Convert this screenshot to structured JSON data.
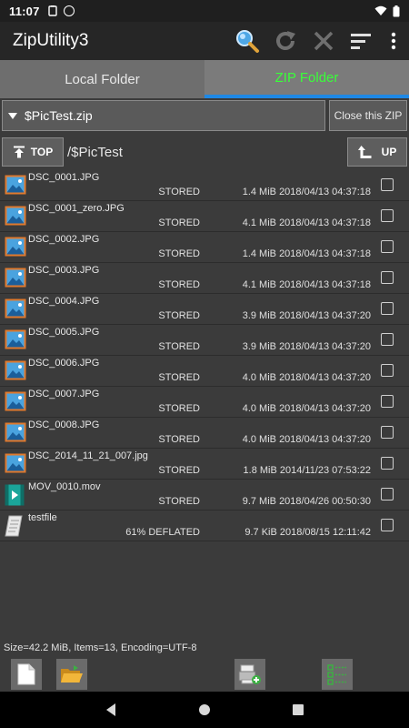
{
  "status_bar": {
    "time": "11:07"
  },
  "app": {
    "title": "ZipUtility3"
  },
  "tabs": [
    {
      "label": "Local Folder",
      "active": false
    },
    {
      "label": "ZIP Folder",
      "active": true
    }
  ],
  "zip": {
    "selected": "$PicTest.zip",
    "close_label": "Close this ZIP"
  },
  "nav": {
    "top_label": "TOP",
    "path": "/$PicTest",
    "up_label": "UP"
  },
  "files": [
    {
      "name": "DSC_0001.JPG",
      "method": "STORED",
      "size": "1.4 MiB",
      "datetime": "2018/04/13 04:37:18",
      "type": "image",
      "checked": false
    },
    {
      "name": "DSC_0001_zero.JPG",
      "method": "STORED",
      "size": "4.1 MiB",
      "datetime": "2018/04/13 04:37:18",
      "type": "image",
      "checked": false
    },
    {
      "name": "DSC_0002.JPG",
      "method": "STORED",
      "size": "1.4 MiB",
      "datetime": "2018/04/13 04:37:18",
      "type": "image",
      "checked": false
    },
    {
      "name": "DSC_0003.JPG",
      "method": "STORED",
      "size": "4.1 MiB",
      "datetime": "2018/04/13 04:37:18",
      "type": "image",
      "checked": false
    },
    {
      "name": "DSC_0004.JPG",
      "method": "STORED",
      "size": "3.9 MiB",
      "datetime": "2018/04/13 04:37:20",
      "type": "image",
      "checked": false
    },
    {
      "name": "DSC_0005.JPG",
      "method": "STORED",
      "size": "3.9 MiB",
      "datetime": "2018/04/13 04:37:20",
      "type": "image",
      "checked": false
    },
    {
      "name": "DSC_0006.JPG",
      "method": "STORED",
      "size": "4.0 MiB",
      "datetime": "2018/04/13 04:37:20",
      "type": "image",
      "checked": false
    },
    {
      "name": "DSC_0007.JPG",
      "method": "STORED",
      "size": "4.0 MiB",
      "datetime": "2018/04/13 04:37:20",
      "type": "image",
      "checked": false
    },
    {
      "name": "DSC_0008.JPG",
      "method": "STORED",
      "size": "4.0 MiB",
      "datetime": "2018/04/13 04:37:20",
      "type": "image",
      "checked": false
    },
    {
      "name": "DSC_2014_11_21_007.jpg",
      "method": "STORED",
      "size": "1.8 MiB",
      "datetime": "2014/11/23 07:53:22",
      "type": "image",
      "checked": false
    },
    {
      "name": "MOV_0010.mov",
      "method": "STORED",
      "size": "9.7 MiB",
      "datetime": "2018/04/26 00:50:30",
      "type": "video",
      "checked": false
    },
    {
      "name": "testfile",
      "method": "61% DEFLATED",
      "size": "9.7 KiB",
      "datetime": "2018/08/15 12:11:42",
      "type": "file",
      "checked": false
    }
  ],
  "footer": {
    "summary": "Size=42.2 MiB, Items=13, Encoding=UTF-8"
  },
  "colors": {
    "active_tab_text": "#39ff39",
    "tab_indicator": "#1e88e5"
  }
}
